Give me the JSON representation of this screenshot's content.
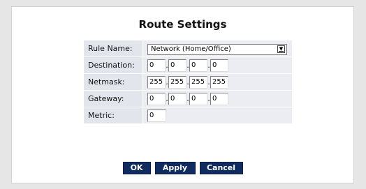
{
  "title": "Route Settings",
  "rule_name": {
    "label": "Rule Name:",
    "selected": "Network (Home/Office)"
  },
  "destination": {
    "label": "Destination:",
    "octets": [
      "0",
      "0",
      "0",
      "0"
    ]
  },
  "netmask": {
    "label": "Netmask:",
    "octets": [
      "255",
      "255",
      "255",
      "255"
    ]
  },
  "gateway": {
    "label": "Gateway:",
    "octets": [
      "0",
      "0",
      "0",
      "0"
    ]
  },
  "metric": {
    "label": "Metric:",
    "value": "0"
  },
  "buttons": {
    "ok": "OK",
    "apply": "Apply",
    "cancel": "Cancel"
  },
  "colors": {
    "button_bg": "#0f2b5f",
    "label_bg": "#e2e5ec",
    "value_bg": "#ebedf2"
  }
}
